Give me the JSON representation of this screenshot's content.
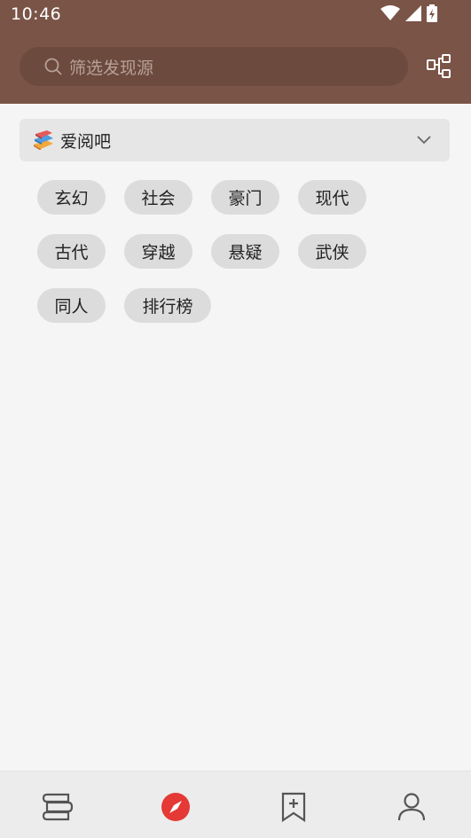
{
  "status_bar": {
    "time": "10:46"
  },
  "search": {
    "placeholder": "筛选发现源"
  },
  "source": {
    "name": "爱阅吧"
  },
  "tags": [
    "玄幻",
    "社会",
    "豪门",
    "现代",
    "古代",
    "穿越",
    "悬疑",
    "武侠",
    "同人",
    "排行榜"
  ],
  "colors": {
    "header": "#7a5446",
    "accent": "#e53935"
  },
  "nav": [
    {
      "icon": "bookshelf-icon"
    },
    {
      "icon": "compass-icon",
      "active": true
    },
    {
      "icon": "bookmark-add-icon"
    },
    {
      "icon": "person-icon"
    }
  ]
}
